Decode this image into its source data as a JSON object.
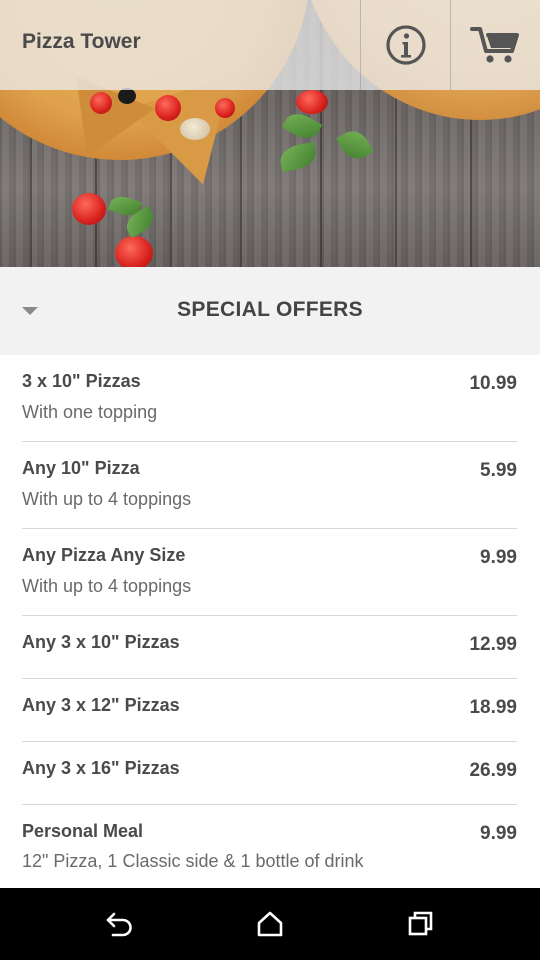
{
  "app": {
    "title": "Pizza Tower"
  },
  "toolbar": {
    "info_icon": "info-icon",
    "cart_icon": "cart-icon"
  },
  "section": {
    "title": "SPECIAL OFFERS"
  },
  "offers": [
    {
      "name": "3 x 10\" Pizzas",
      "desc": "With one topping",
      "price": "10.99"
    },
    {
      "name": "Any 10\" Pizza",
      "desc": "With up to 4 toppings",
      "price": "5.99"
    },
    {
      "name": "Any Pizza Any Size",
      "desc": "With up to 4 toppings",
      "price": "9.99"
    },
    {
      "name": "Any 3 x 10\" Pizzas",
      "desc": "",
      "price": "12.99"
    },
    {
      "name": "Any 3 x 12\" Pizzas",
      "desc": "",
      "price": "18.99"
    },
    {
      "name": "Any 3 x 16\" Pizzas",
      "desc": "",
      "price": "26.99"
    },
    {
      "name": "Personal Meal",
      "desc": "12\" Pizza, 1 Classic side & 1 bottle of drink",
      "price": "9.99"
    }
  ],
  "navbar": {
    "back_icon": "back-icon",
    "home_icon": "home-icon",
    "recents_icon": "recents-icon"
  },
  "colors": {
    "text_dark": "#4a4a4a",
    "text_muted": "#6a6a6a",
    "section_bg": "#f2f2f2",
    "nav_bg": "#000000"
  }
}
